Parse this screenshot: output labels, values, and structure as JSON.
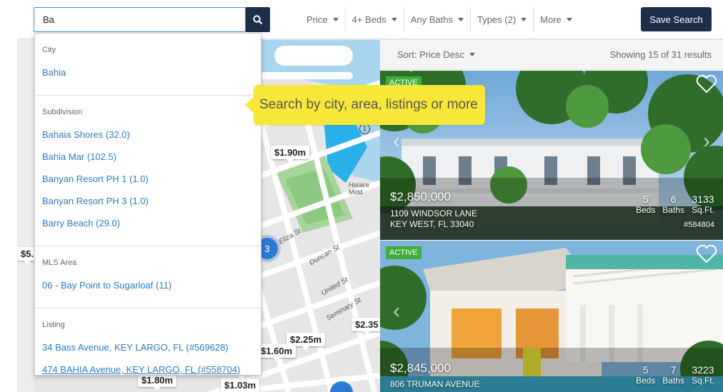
{
  "search": {
    "value": "Ba",
    "button_icon": "search-icon"
  },
  "filters": [
    {
      "label": "Price"
    },
    {
      "label": "4+ Beds"
    },
    {
      "label": "Any Baths"
    },
    {
      "label": "Types (2)"
    },
    {
      "label": "More"
    }
  ],
  "save_search_label": "Save Search",
  "colors": {
    "navy": "#1b2f4b",
    "link": "#2d7bbf",
    "active_badge": "#3fae3c",
    "tooltip": "#f7e739"
  },
  "dropdown": {
    "groups": [
      {
        "heading": "City",
        "items": [
          "Bahia"
        ]
      },
      {
        "heading": "Subdivision",
        "items": [
          "Bahaia Shores (32.0)",
          "Bahia Mar (102.5)",
          "Banyan Resort PH 1 (1.0)",
          "Banyan Resort PH 3 (1.0)",
          "Barry Beach (29.0)"
        ]
      },
      {
        "heading": "MLS Area",
        "items": [
          "06 - Bay Point to Sugarloaf (11)"
        ]
      },
      {
        "heading": "Listing",
        "items": [
          "34 Bass Avenue, KEY LARGO, FL (#569628)",
          "474 BAHIA Avenue, KEY LARGO, FL (#558704)"
        ]
      }
    ]
  },
  "tooltip": "Search by city, area, listings or more",
  "map": {
    "pins": [
      "$1.90m",
      "$2.25m",
      "$1.60m",
      "$1.80m",
      "$1.03m",
      "$2.35",
      "$5."
    ],
    "cluster": "3",
    "streets": [
      "Duncan St",
      "United St",
      "Seminary St",
      "Horace Midd",
      "Eliza St"
    ],
    "marker": "1"
  },
  "results": {
    "sort_label": "Sort: Price Desc",
    "showing": "Showing 15 of 31 results",
    "cards": [
      {
        "status": "ACTIVE",
        "price": "$2,850,000",
        "address1": "1109 WINDSOR LANE",
        "address2": "KEY WEST, FL 33040",
        "beds": "5",
        "baths": "6",
        "sqft": "3133",
        "beds_label": "Beds",
        "baths_label": "Baths",
        "sqft_label": "Sq.Ft.",
        "mls": "#584804"
      },
      {
        "status": "ACTIVE",
        "price": "$2,845,000",
        "address1": "806 TRUMAN AVENUE",
        "beds": "5",
        "baths": "7",
        "sqft": "3223",
        "beds_label": "Beds",
        "baths_label": "Baths",
        "sqft_label": "Sq.Ft."
      }
    ]
  }
}
